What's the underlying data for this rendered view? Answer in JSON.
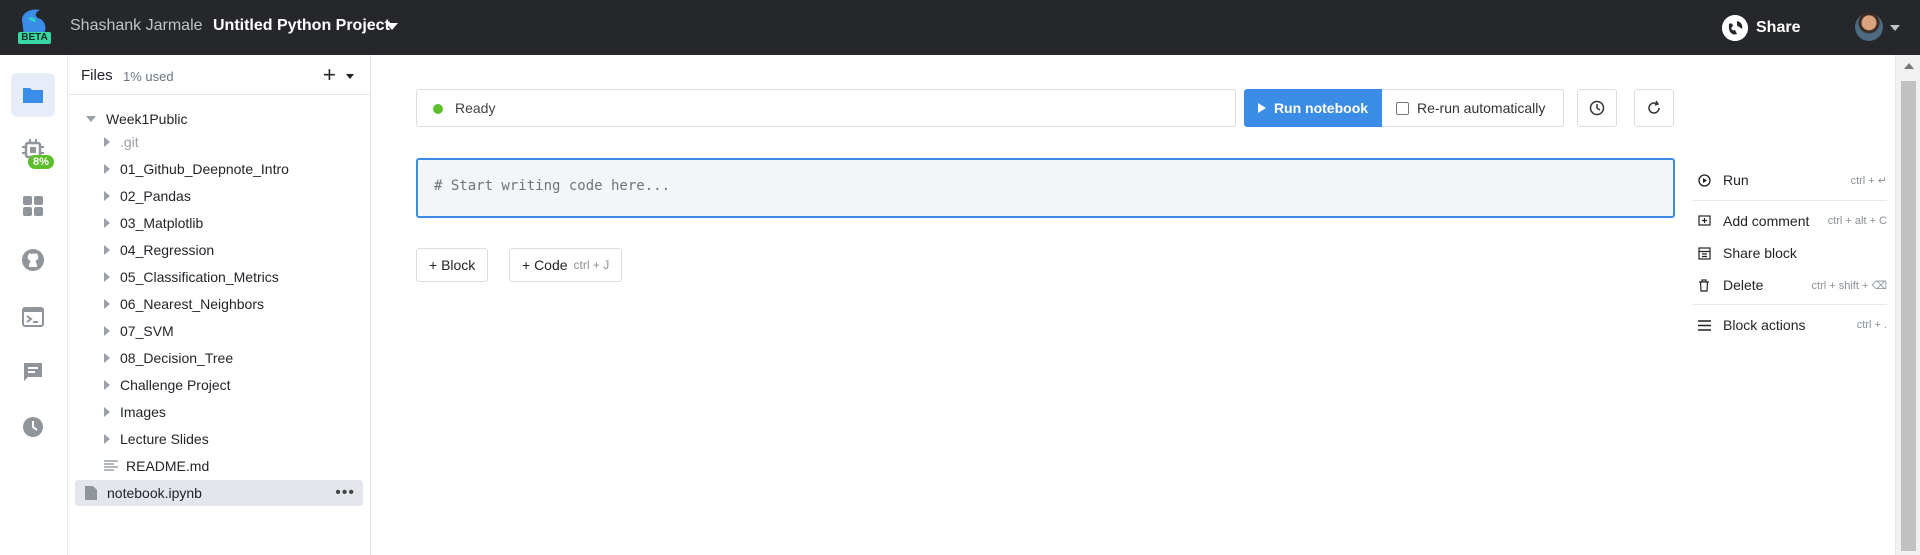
{
  "topbar": {
    "beta_label": "BETA",
    "user_name": "Shashank Jarmale",
    "project_title": "Untitled Python Project",
    "share_label": "Share"
  },
  "rail": {
    "items": [
      "files-icon",
      "machine-icon",
      "integrations-icon",
      "github-icon",
      "terminal-icon",
      "comments-icon",
      "history-icon"
    ],
    "badge": "8%"
  },
  "files": {
    "title": "Files",
    "usage": "1% used",
    "tree": [
      {
        "label": "Week1Public",
        "kind": "folder-open"
      },
      {
        "label": ".git",
        "kind": "folder"
      },
      {
        "label": "01_Github_Deepnote_Intro",
        "kind": "folder"
      },
      {
        "label": "02_Pandas",
        "kind": "folder"
      },
      {
        "label": "03_Matplotlib",
        "kind": "folder"
      },
      {
        "label": "04_Regression",
        "kind": "folder"
      },
      {
        "label": "05_Classification_Metrics",
        "kind": "folder"
      },
      {
        "label": "06_Nearest_Neighbors",
        "kind": "folder"
      },
      {
        "label": "07_SVM",
        "kind": "folder"
      },
      {
        "label": "08_Decision_Tree",
        "kind": "folder"
      },
      {
        "label": "Challenge Project",
        "kind": "folder"
      },
      {
        "label": "Images",
        "kind": "folder"
      },
      {
        "label": "Lecture Slides",
        "kind": "folder"
      },
      {
        "label": "README.md",
        "kind": "file-text"
      },
      {
        "label": "notebook.ipynb",
        "kind": "file-selected"
      }
    ]
  },
  "toolbar": {
    "status": "Ready",
    "run_label": "Run notebook",
    "rerun_label": "Re-run automatically"
  },
  "editor": {
    "placeholder": "# Start writing code here..."
  },
  "add": {
    "block_label": "+ Block",
    "code_label": "+ Code",
    "code_shortcut": "ctrl + J"
  },
  "actions": [
    {
      "label": "Run",
      "shortcut": "ctrl + ↵",
      "icon": "play-circle-icon"
    },
    {
      "label": "Add comment",
      "shortcut": "ctrl + alt + C",
      "icon": "comment-add-icon"
    },
    {
      "label": "Share block",
      "shortcut": "",
      "icon": "share-block-icon"
    },
    {
      "label": "Delete",
      "shortcut": "ctrl + shift + ⌫",
      "icon": "trash-icon"
    },
    {
      "label": "Block actions",
      "shortcut": "ctrl + .",
      "icon": "menu-icon"
    }
  ],
  "colors": {
    "topbar": "#25272b",
    "accent": "#3b8ce6",
    "status_ok": "#5cbf2a",
    "beta": "#39d8a2"
  }
}
